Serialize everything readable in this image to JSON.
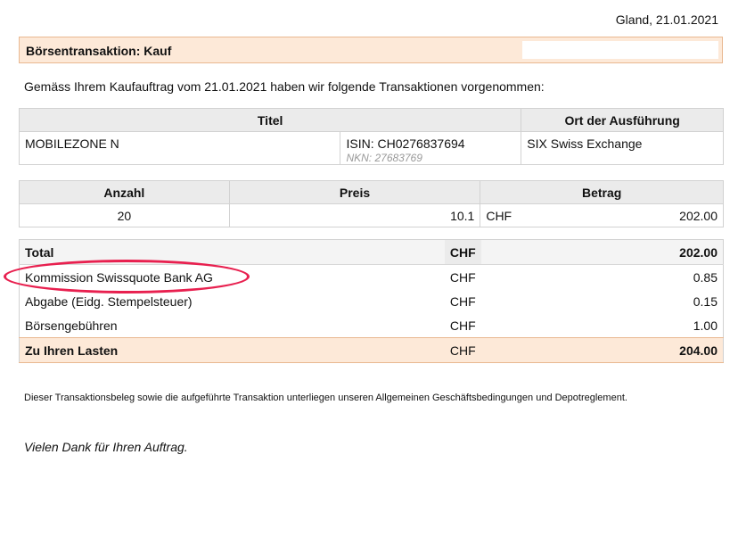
{
  "header": {
    "place_date": "Gland, 21.01.2021",
    "title": "Börsentransaktion: Kauf"
  },
  "intro": "Gemäss Ihrem Kaufauftrag vom 21.01.2021 haben wir folgende Transaktionen vorgenommen:",
  "security_table": {
    "headers": {
      "titel": "Titel",
      "ort": "Ort der Ausführung"
    },
    "row": {
      "name": "MOBILEZONE N",
      "isin": "ISIN: CH0276837694",
      "nkn": "NKN: 27683769",
      "venue": "SIX Swiss Exchange"
    }
  },
  "trade_table": {
    "headers": {
      "anzahl": "Anzahl",
      "preis": "Preis",
      "betrag": "Betrag"
    },
    "row": {
      "anzahl": "20",
      "preis": "10.1",
      "currency": "CHF",
      "betrag": "202.00"
    }
  },
  "totals": {
    "total": {
      "label": "Total",
      "currency": "CHF",
      "amount": "202.00"
    },
    "items": [
      {
        "label": "Kommission Swissquote Bank AG",
        "currency": "CHF",
        "amount": "0.85"
      },
      {
        "label": "Abgabe (Eidg. Stempelsteuer)",
        "currency": "CHF",
        "amount": "0.15"
      },
      {
        "label": "Börsengebühren",
        "currency": "CHF",
        "amount": "1.00"
      }
    ],
    "final": {
      "label": "Zu Ihren Lasten",
      "currency": "CHF",
      "amount": "204.00"
    }
  },
  "disclaimer": "Dieser Transaktionsbeleg sowie die aufgeführte Transaktion unterliegen unseren Allgemeinen Geschäftsbedingungen und Depotreglement.",
  "closing": "Vielen Dank für Ihren Auftrag.",
  "colors": {
    "banner_bg": "#fde9d8",
    "banner_border": "#e9b891",
    "highlight": "#e8204f"
  }
}
